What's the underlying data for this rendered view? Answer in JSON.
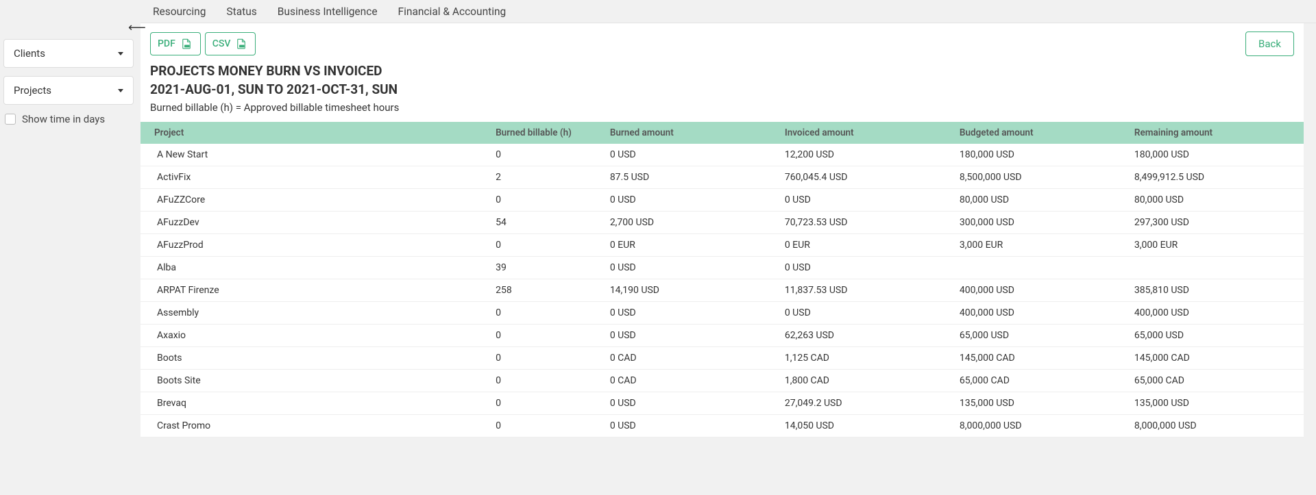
{
  "tabs": [
    "Resourcing",
    "Status",
    "Business Intelligence",
    "Financial & Accounting"
  ],
  "sidebar": {
    "clients_label": "Clients",
    "projects_label": "Projects",
    "show_time_days": "Show time in days"
  },
  "toolbar": {
    "pdf": "PDF",
    "csv": "CSV",
    "back": "Back"
  },
  "report": {
    "title": "PROJECTS MONEY BURN VS INVOICED",
    "daterange": "2021-AUG-01, SUN TO 2021-OCT-31, SUN",
    "subtitle": "Burned billable (h) = Approved billable timesheet hours"
  },
  "columns": [
    "Project",
    "Burned billable (h)",
    "Burned amount",
    "Invoiced amount",
    "Budgeted amount",
    "Remaining amount"
  ],
  "rows": [
    {
      "project": "A New Start",
      "burned_h": "0",
      "burned_amt": "0 USD",
      "invoiced": "12,200 USD",
      "budgeted": "180,000 USD",
      "remaining": "180,000 USD"
    },
    {
      "project": "ActivFix",
      "burned_h": "2",
      "burned_amt": "87.5 USD",
      "invoiced": "760,045.4 USD",
      "budgeted": "8,500,000 USD",
      "remaining": "8,499,912.5 USD"
    },
    {
      "project": "AFuZZCore",
      "burned_h": "0",
      "burned_amt": "0 USD",
      "invoiced": "0 USD",
      "budgeted": "80,000 USD",
      "remaining": "80,000 USD"
    },
    {
      "project": "AFuzzDev",
      "burned_h": "54",
      "burned_amt": "2,700 USD",
      "invoiced": "70,723.53 USD",
      "budgeted": "300,000 USD",
      "remaining": "297,300 USD"
    },
    {
      "project": "AFuzzProd",
      "burned_h": "0",
      "burned_amt": "0 EUR",
      "invoiced": "0 EUR",
      "budgeted": "3,000 EUR",
      "remaining": "3,000 EUR"
    },
    {
      "project": "Alba",
      "burned_h": "39",
      "burned_amt": "0 USD",
      "invoiced": "0 USD",
      "budgeted": "",
      "remaining": ""
    },
    {
      "project": "ARPAT Firenze",
      "burned_h": "258",
      "burned_amt": "14,190 USD",
      "invoiced": "11,837.53 USD",
      "budgeted": "400,000 USD",
      "remaining": "385,810 USD"
    },
    {
      "project": "Assembly",
      "burned_h": "0",
      "burned_amt": "0 USD",
      "invoiced": "0 USD",
      "budgeted": "400,000 USD",
      "remaining": "400,000 USD"
    },
    {
      "project": "Axaxio",
      "burned_h": "0",
      "burned_amt": "0 USD",
      "invoiced": "62,263 USD",
      "budgeted": "65,000 USD",
      "remaining": "65,000 USD"
    },
    {
      "project": "Boots",
      "burned_h": "0",
      "burned_amt": "0 CAD",
      "invoiced": "1,125 CAD",
      "budgeted": "145,000 CAD",
      "remaining": "145,000 CAD"
    },
    {
      "project": "Boots Site",
      "burned_h": "0",
      "burned_amt": "0 CAD",
      "invoiced": "1,800 CAD",
      "budgeted": "65,000 CAD",
      "remaining": "65,000 CAD"
    },
    {
      "project": "Brevaq",
      "burned_h": "0",
      "burned_amt": "0 USD",
      "invoiced": "27,049.2 USD",
      "budgeted": "135,000 USD",
      "remaining": "135,000 USD"
    },
    {
      "project": "Crast Promo",
      "burned_h": "0",
      "burned_amt": "0 USD",
      "invoiced": "14,050 USD",
      "budgeted": "8,000,000 USD",
      "remaining": "8,000,000 USD"
    }
  ]
}
